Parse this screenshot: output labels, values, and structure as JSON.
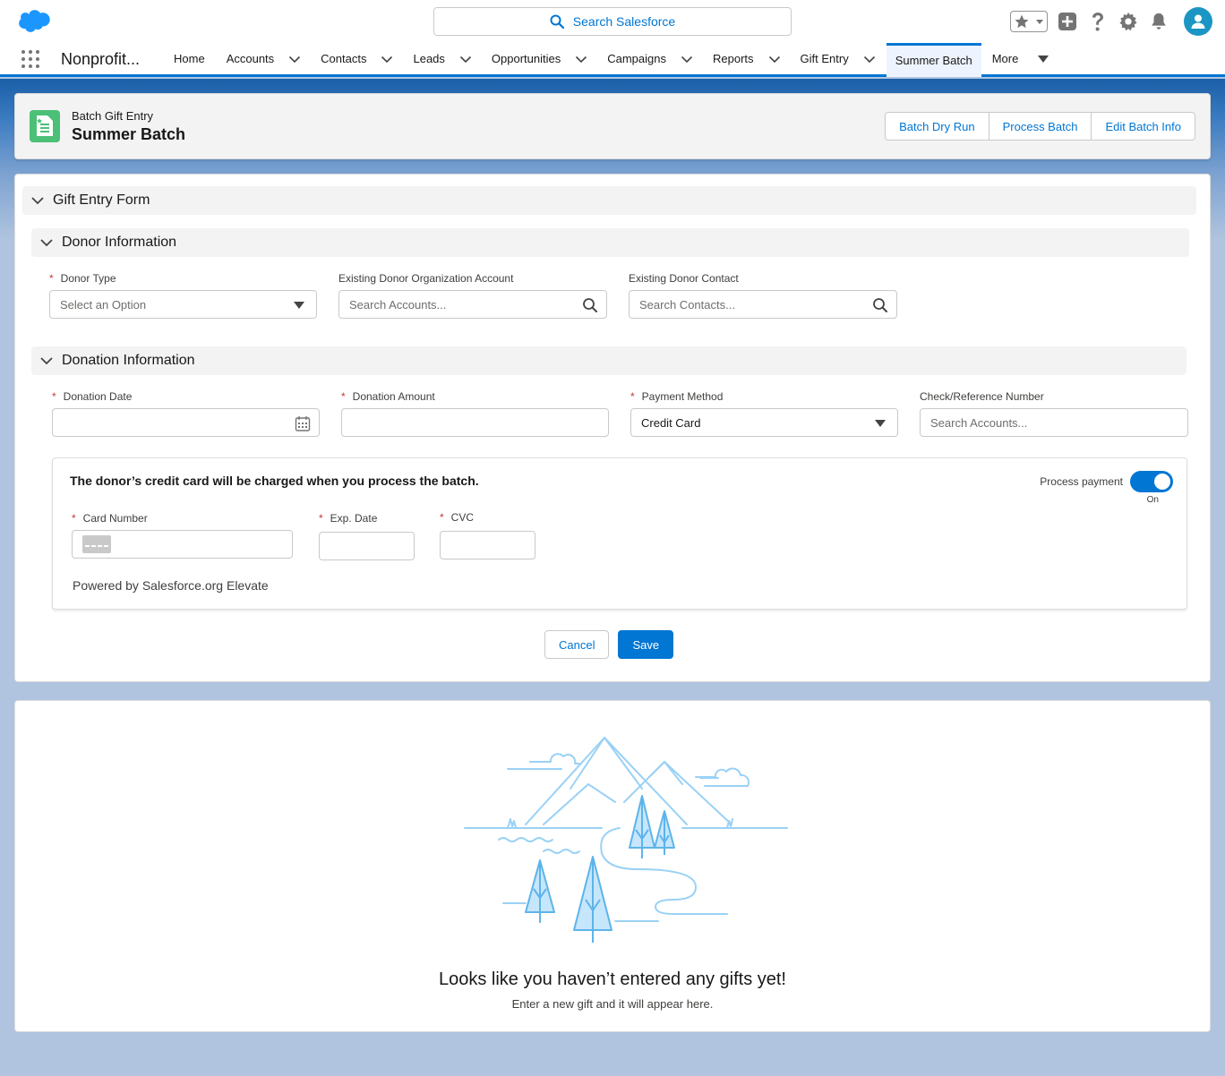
{
  "header": {
    "search_placeholder": "Search Salesforce"
  },
  "nav": {
    "app_name": "Nonprofit...",
    "items": [
      {
        "label": "Home"
      },
      {
        "label": "Accounts"
      },
      {
        "label": "Contacts"
      },
      {
        "label": "Leads"
      },
      {
        "label": "Opportunities"
      },
      {
        "label": "Campaigns"
      },
      {
        "label": "Reports"
      },
      {
        "label": "Gift Entry"
      },
      {
        "label": "Summer Batch"
      },
      {
        "label": "More"
      }
    ]
  },
  "page_header": {
    "record_type": "Batch Gift Entry",
    "title": "Summer Batch",
    "buttons": [
      "Batch Dry Run",
      "Process Batch",
      "Edit Batch Info"
    ]
  },
  "form": {
    "section_title": "Gift Entry Form",
    "donor_section": {
      "title": "Donor Information",
      "donor_type": {
        "label": "Donor Type",
        "placeholder": "Select an Option"
      },
      "org_account": {
        "label": "Existing Donor Organization Account",
        "placeholder": "Search Accounts..."
      },
      "contact": {
        "label": "Existing Donor Contact",
        "placeholder": "Search Contacts..."
      }
    },
    "donation_section": {
      "title": "Donation Information",
      "date": {
        "label": "Donation Date",
        "value": ""
      },
      "amount": {
        "label": "Donation Amount",
        "value": ""
      },
      "payment_method": {
        "label": "Payment Method",
        "value": "Credit Card"
      },
      "check_ref": {
        "label": "Check/Reference Number",
        "placeholder": "Search Accounts..."
      }
    },
    "payment": {
      "message": "The donor’s credit card will be charged when you process the batch.",
      "toggle_label": "Process payment",
      "toggle_state": "On",
      "card_number_label": "Card Number",
      "exp_label": "Exp. Date",
      "cvc_label": "CVC",
      "powered_by": "Powered by Salesforce.org Elevate"
    },
    "cancel_label": "Cancel",
    "save_label": "Save"
  },
  "empty_state": {
    "title": "Looks like you haven’t entered any gifts yet!",
    "subtitle": "Enter a new gift and it will appear here."
  },
  "colors": {
    "brand": "#0176d3",
    "cloud": "#1b96ff",
    "record_icon": "#4bc076",
    "required": "#c23934"
  }
}
